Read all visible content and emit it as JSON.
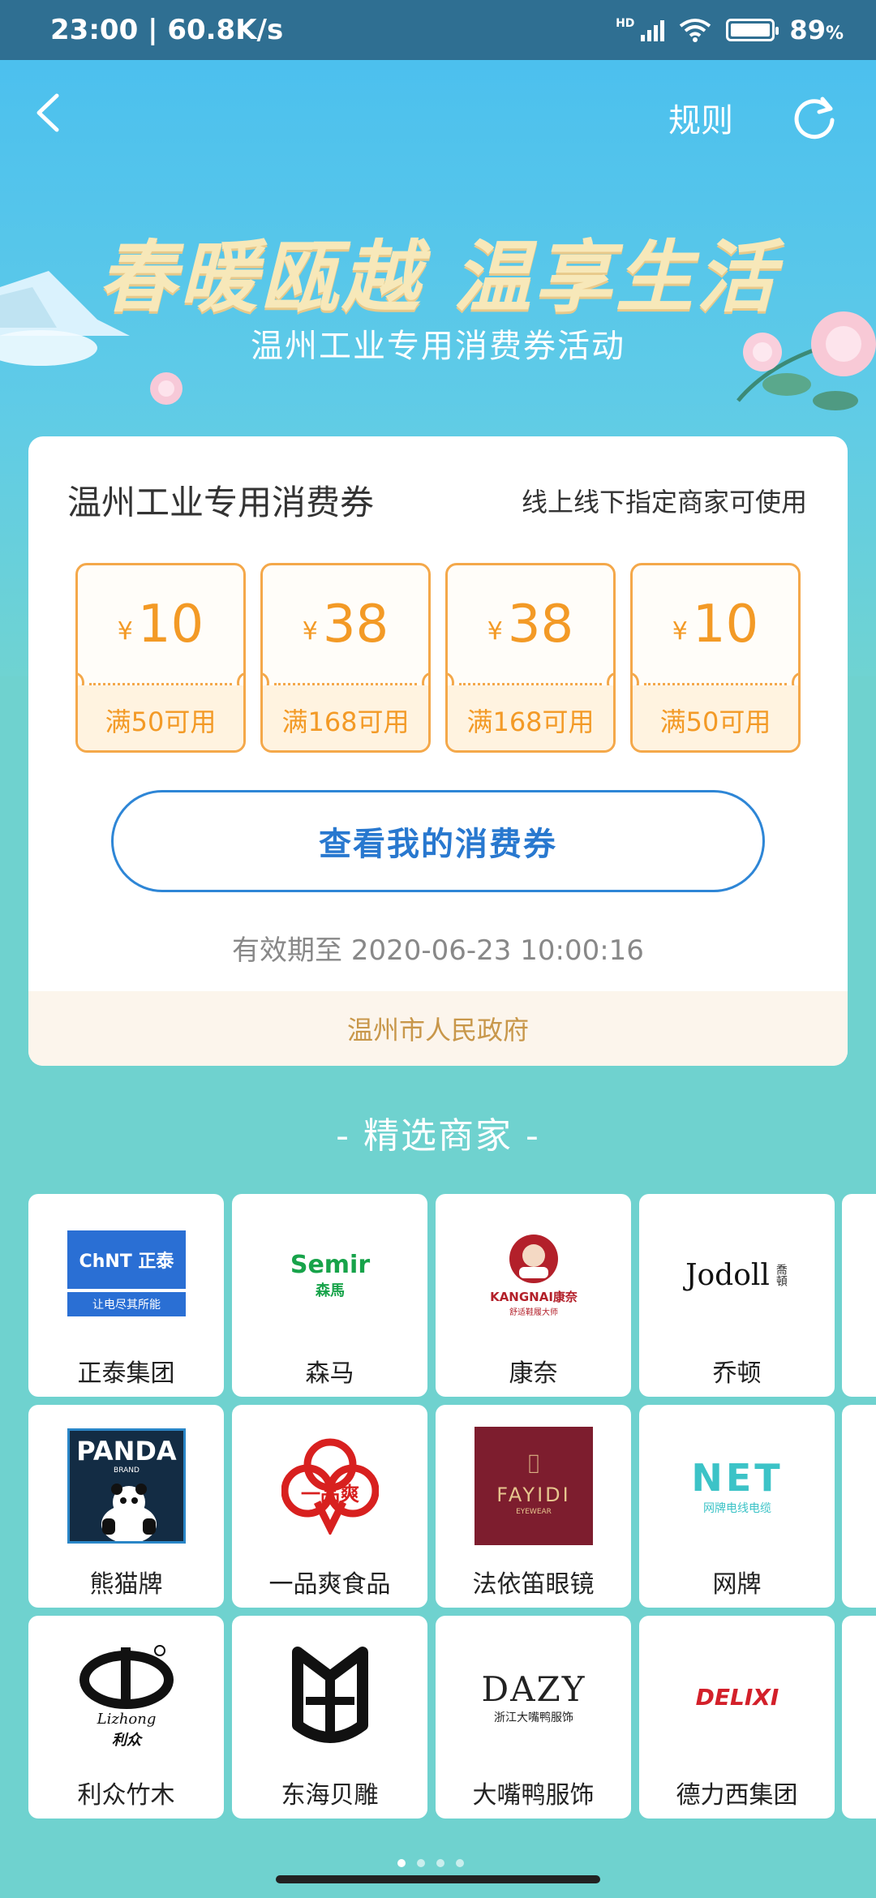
{
  "status_bar": {
    "time_speed": "23:00 | 60.8K/s",
    "network_label": "HD",
    "battery": "89",
    "battery_unit": "%"
  },
  "nav": {
    "rules_label": "规则"
  },
  "banner": {
    "headline": "春暖瓯越 温享生活",
    "subline": "温州工业专用消费券活动"
  },
  "voucher_card": {
    "title": "温州工业专用消费券",
    "usage_note": "线上线下指定商家可使用",
    "currency": "¥",
    "coupons": [
      {
        "amount": "10",
        "condition": "满50可用"
      },
      {
        "amount": "38",
        "condition": "满168可用"
      },
      {
        "amount": "38",
        "condition": "满168可用"
      },
      {
        "amount": "10",
        "condition": "满50可用"
      }
    ],
    "view_button": "查看我的消费券",
    "validity": "有效期至 2020-06-23 10:00:16",
    "issuer": "温州市人民政府"
  },
  "merchants_section": {
    "title": "- 精选商家 -",
    "merchants": [
      {
        "name": "正泰集团",
        "logo_text": "ChNT 正泰",
        "logo_sub": "让电尽其所能"
      },
      {
        "name": "森马",
        "logo_text": "Semir",
        "logo_sub": "森馬"
      },
      {
        "name": "康奈",
        "logo_text": "KANGNAI康奈",
        "logo_sub": "舒适鞋履大师"
      },
      {
        "name": "乔顿",
        "logo_text": "Jodoll",
        "logo_sub": "喬頓"
      },
      {
        "name": "熊猫牌",
        "logo_text": "PANDA",
        "logo_sub": "BRAND"
      },
      {
        "name": "一品爽食品",
        "logo_text": "一品爽",
        "logo_sub": ""
      },
      {
        "name": "法依笛眼镜",
        "logo_text": "FAYIDI",
        "logo_sub": "EYEWEAR"
      },
      {
        "name": "网牌",
        "logo_text": "NET",
        "logo_sub": "网牌电线电缆"
      },
      {
        "name": "利众竹木",
        "logo_text": "Lizhong",
        "logo_sub": "利众"
      },
      {
        "name": "东海贝雕",
        "logo_text": "",
        "logo_sub": ""
      },
      {
        "name": "大嘴鸭服饰",
        "logo_text": "DAZY",
        "logo_sub": "浙江大嘴鸭服饰"
      },
      {
        "name": "德力西集团",
        "logo_text": "DELIXI",
        "logo_sub": ""
      }
    ]
  },
  "colors": {
    "accent_orange": "#f39a26",
    "button_blue": "#2878cf",
    "issuer_gold": "#c8974a",
    "page_teal": "#6fd2cf"
  }
}
